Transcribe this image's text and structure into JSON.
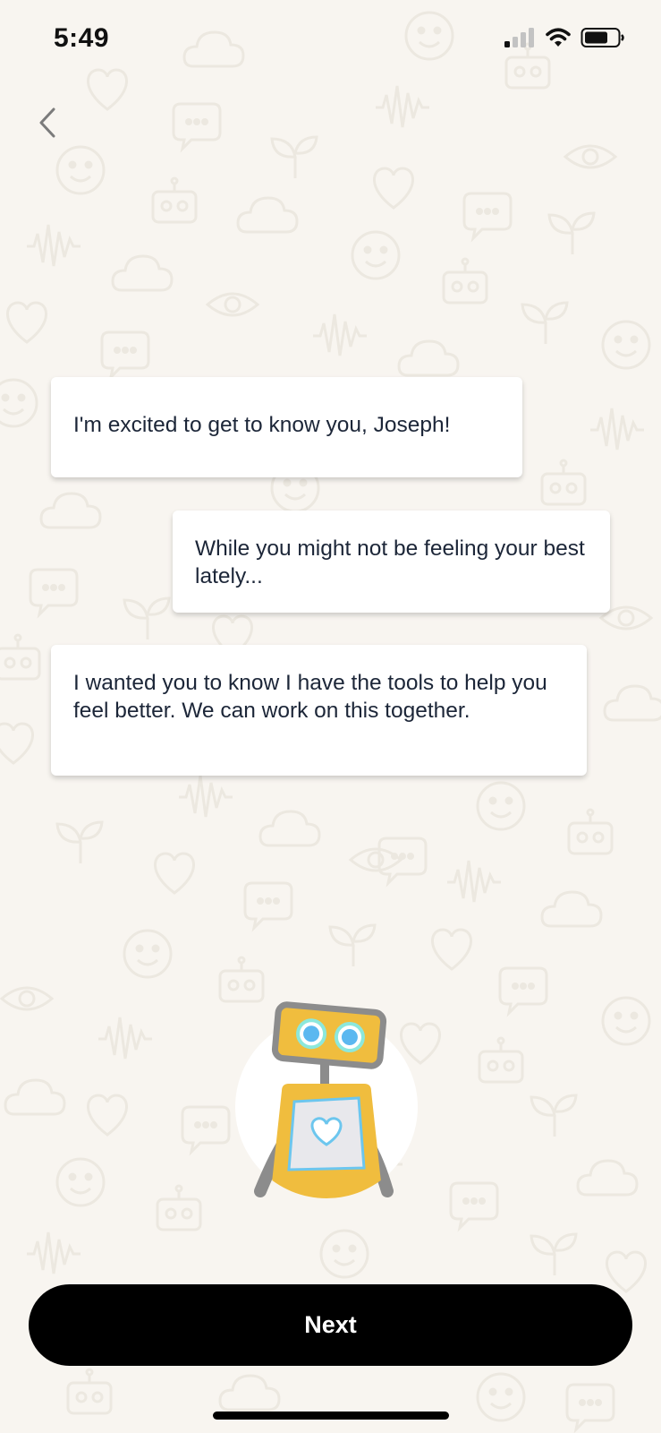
{
  "status_bar": {
    "time": "5:49",
    "icons": [
      "cellular-signal-icon",
      "wifi-icon",
      "battery-icon"
    ]
  },
  "nav": {
    "back_icon": "chevron-left-icon"
  },
  "messages": [
    {
      "text": "I'm excited to get to know you, Joseph!"
    },
    {
      "text": "While you might not be feeling your best lately..."
    },
    {
      "text": "I wanted you to know I have the tools to help you feel better. We can work on this together."
    }
  ],
  "mascot": {
    "icon": "robot-mascot-icon"
  },
  "footer": {
    "next_label": "Next"
  },
  "colors": {
    "background": "#f8f5f0",
    "pattern": "#eeeae3",
    "bubble": "#ffffff",
    "text": "#1c2638",
    "button": "#000000",
    "button_text": "#ffffff",
    "robot_body": "#f0bd3e",
    "robot_gray": "#8c8c8c",
    "robot_eye": "#5bb8f0",
    "robot_heart": "#6cc6ee"
  }
}
